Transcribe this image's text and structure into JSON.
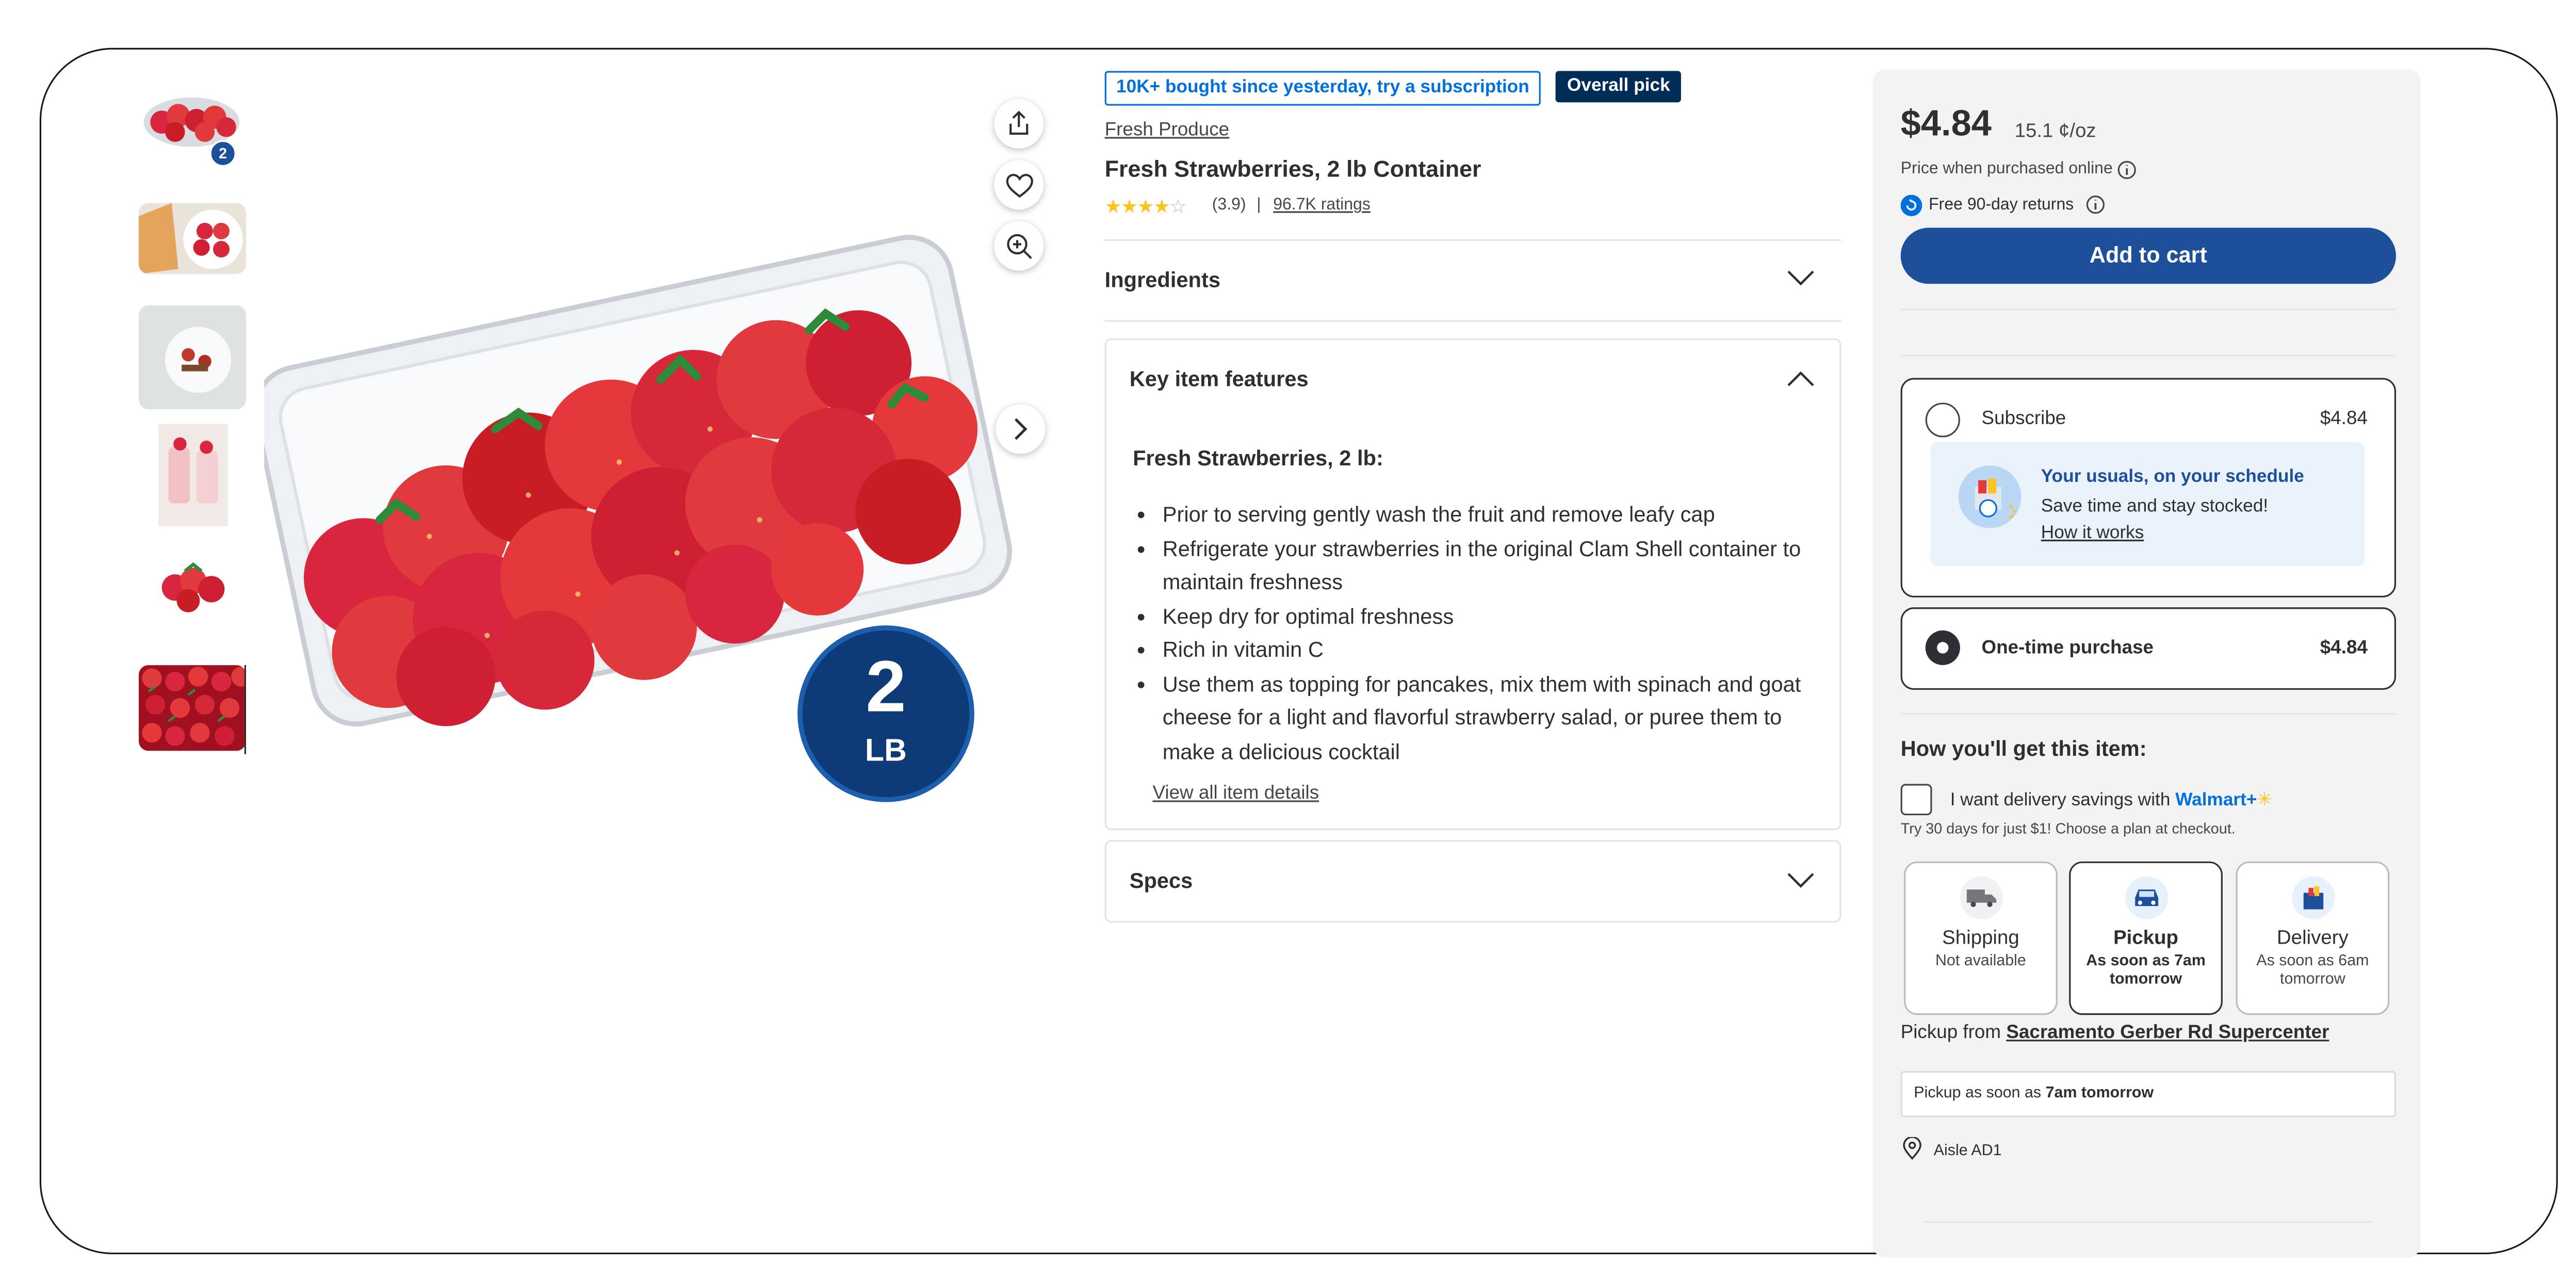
{
  "gallery": {
    "badge_count": "2"
  },
  "hero": {
    "pack_size_number": "2",
    "pack_size_unit": "LB"
  },
  "product": {
    "tag_popular": "10K+ bought since yesterday, try a subscription",
    "tag_pick": "Overall pick",
    "category": "Fresh Produce",
    "title": "Fresh Strawberries, 2 lb Container",
    "rating_value": "(3.9)",
    "rating_stars": 3.9,
    "rating_sep": "|",
    "rating_count": "96.7K ratings"
  },
  "sections": {
    "ingredients": "Ingredients",
    "key_features": "Key item features",
    "specs": "Specs"
  },
  "features": {
    "subtitle": "Fresh Strawberries, 2 lb:",
    "items": [
      "Prior to serving gently wash the fruit and remove leafy cap",
      "Refrigerate your strawberries in the original Clam Shell container to maintain freshness",
      "Keep dry for optimal freshness",
      "Rich in vitamin C",
      "Use them as topping for pancakes, mix them with spinach and goat cheese for a light and flavorful strawberry salad, or puree them to make a delicious cocktail"
    ],
    "view_all": "View all item details"
  },
  "buybox": {
    "price": "$4.84",
    "unit_price": "15.1 ¢/oz",
    "price_note": "Price when purchased online",
    "returns": "Free 90-day returns",
    "add_to_cart": "Add to cart",
    "subscribe_label": "Subscribe",
    "subscribe_price": "$4.84",
    "promo_title": "Your usuals, on your schedule",
    "promo_text": "Save time and stay stocked!",
    "promo_link": "How it works",
    "onetime_label": "One-time purchase",
    "onetime_price": "$4.84",
    "fulfillment_heading": "How you'll get this item:",
    "walmart_plus_text": "I want delivery savings with",
    "walmart_plus_brand": "Walmart+",
    "walmart_plus_note": "Try 30 days for just $1! Choose a plan at checkout.",
    "options": [
      {
        "title": "Shipping",
        "sub": "Not available"
      },
      {
        "title": "Pickup",
        "sub": "As soon as 7am tomorrow"
      },
      {
        "title": "Delivery",
        "sub": "As soon as 6am tomorrow"
      }
    ],
    "pickup_from_label": "Pickup from",
    "store_name": "Sacramento Gerber Rd Supercenter",
    "pickup_time_prefix": "Pickup as soon as",
    "pickup_time": "7am tomorrow",
    "aisle": "Aisle AD1"
  },
  "colors": {
    "accent_blue": "#1d4f9b",
    "link_blue": "#0071dc",
    "star_gold": "#ffc220",
    "dark_navy": "#002d58"
  }
}
